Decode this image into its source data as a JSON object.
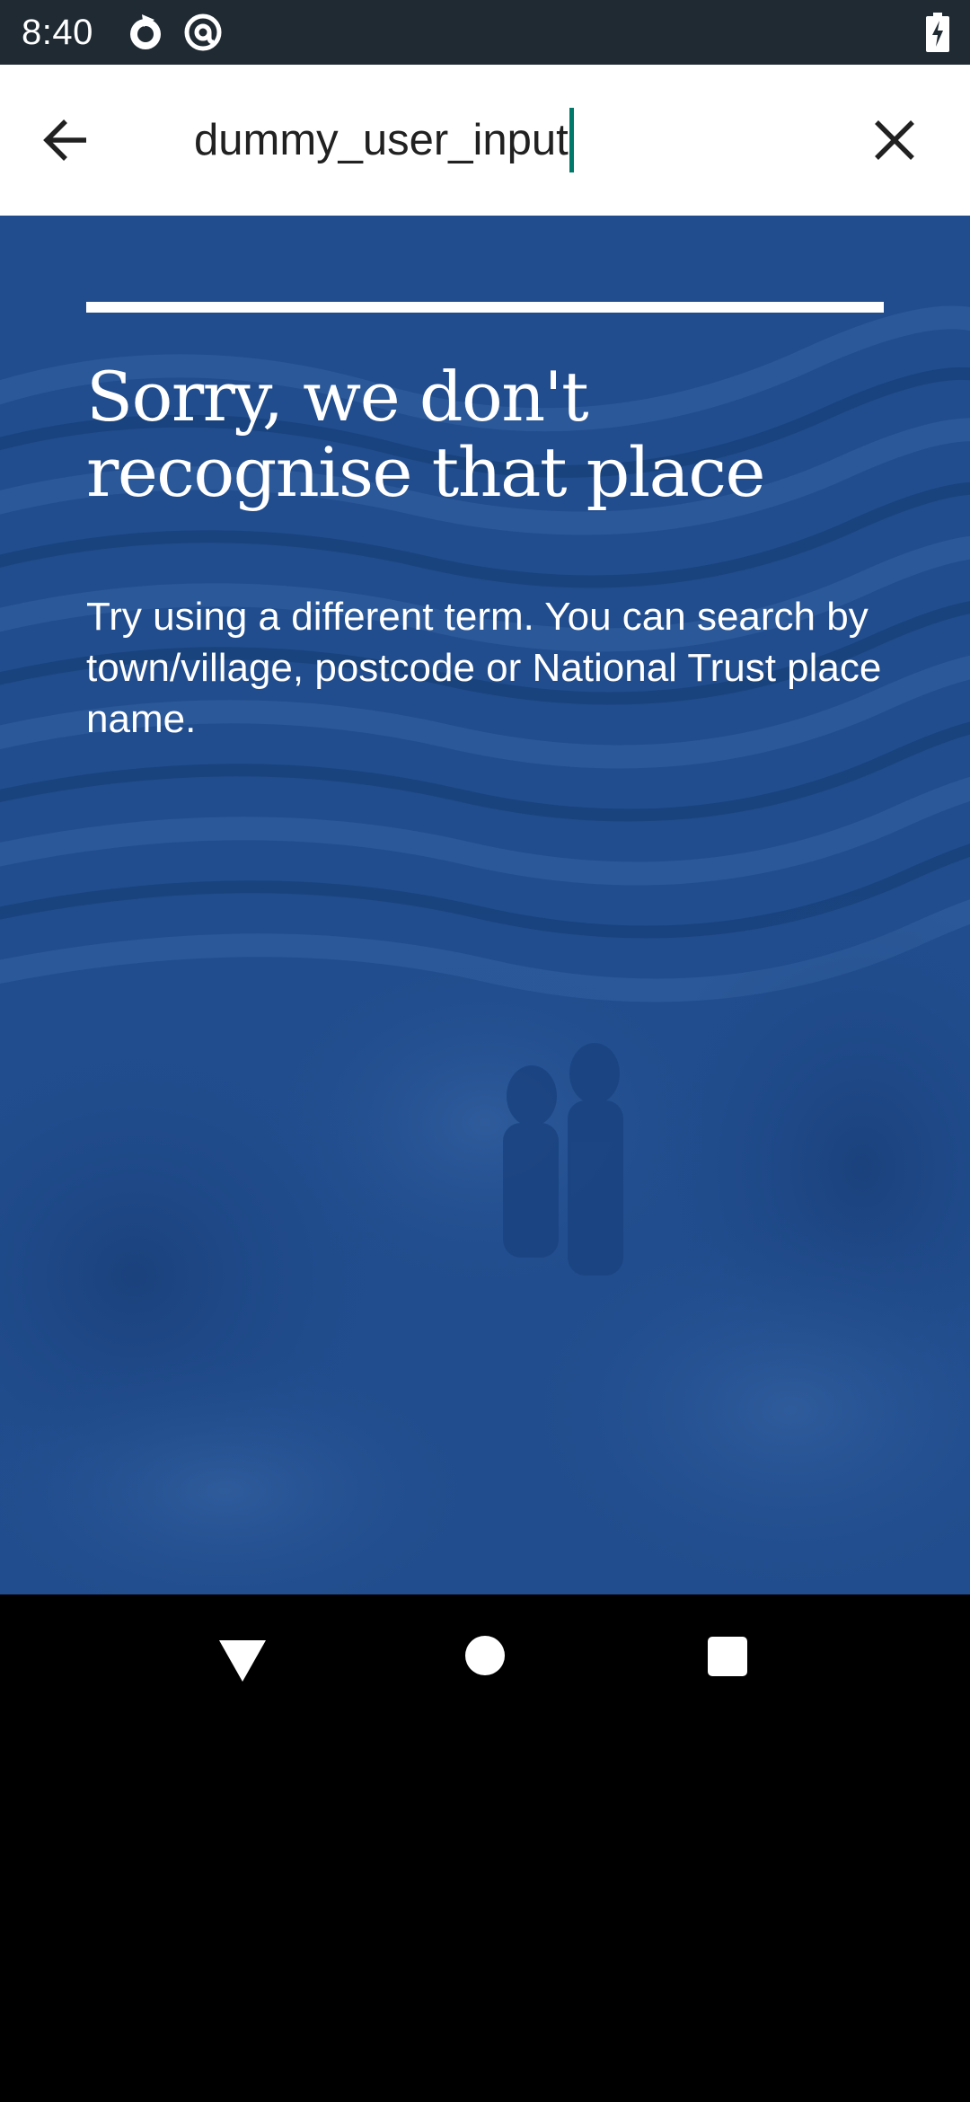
{
  "status_bar": {
    "time": "8:40",
    "icons": [
      "sync-icon",
      "at-sign-icon",
      "battery-charging-icon"
    ]
  },
  "search": {
    "value": "dummy_user_input",
    "back_icon": "arrow-left-icon",
    "clear_icon": "close-icon"
  },
  "message": {
    "heading": "Sorry, we don't recognise that place",
    "body": "Try using a different term. You can search by town/village, postcode or National Trust place name."
  },
  "nav_bar": {
    "icons": [
      "nav-back-icon",
      "nav-home-icon",
      "nav-recents-icon"
    ]
  },
  "colors": {
    "status_bar": "#1f2a33",
    "content_background": "#214d8e",
    "caret": "#00796b",
    "text_light": "#ffffff",
    "text_dark": "#212121"
  }
}
